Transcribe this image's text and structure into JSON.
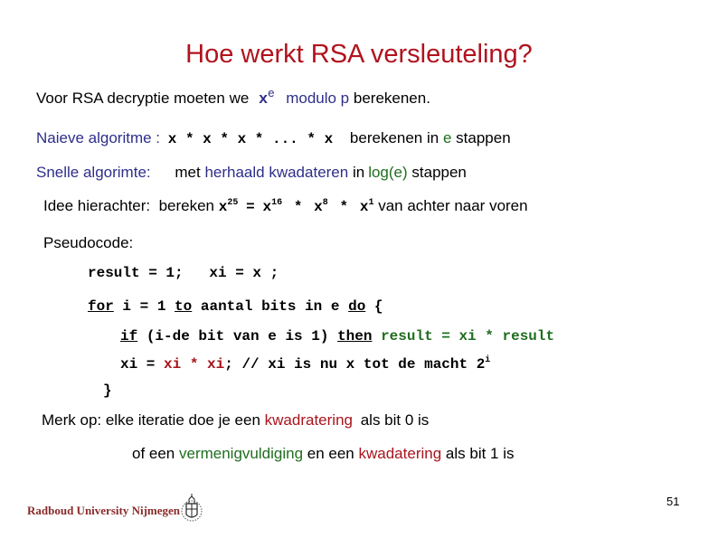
{
  "slide": {
    "title": "Hoe werkt RSA versleuteling?",
    "page_number": "51"
  },
  "line1": {
    "prefix": "Voor RSA decryptie moeten we",
    "math_base": "x",
    "math_exp": "e",
    "highlight": "modulo p",
    "suffix": "berekenen."
  },
  "naive": {
    "label": "Naieve algoritme :",
    "expr": "x * x * x * ... * x",
    "text_a": "berekenen in",
    "var": "e",
    "text_b": "stappen"
  },
  "fast": {
    "label": "Snelle algorimte:",
    "text_a": "met",
    "highlight": "herhaald kwadateren",
    "text_b": "in",
    "log": "log(e)",
    "text_c": "stappen"
  },
  "idea": {
    "prefix": "Idee hierachter:  bereken",
    "x": "x",
    "e25": "25",
    "eq": "=",
    "e16": "16",
    "star": "*",
    "e8": "8",
    "e1": "1",
    "suffix": "van achter naar voren"
  },
  "pseudocode": {
    "label": "Pseudocode:",
    "init": "result = 1;   xi = x ;",
    "for_kw": "for",
    "for_mid": "i = 1",
    "to_kw": "to",
    "for_rest": "aantal bits in e",
    "do_kw": "do",
    "brace_open": "{",
    "if_kw": "if",
    "if_cond": "(i-de bit van e is 1)",
    "then_kw": "then",
    "if_body": "result = xi * result",
    "sq_lhs": "xi =",
    "sq_rhs1": "xi",
    "sq_op": "*",
    "sq_rhs2": "xi",
    "sq_comment": "; // xi is nu x tot de macht 2",
    "sq_sup": "i",
    "brace_close": "}"
  },
  "note": {
    "line1_a": "Merk op: elke iteratie doe je een",
    "line1_red": "kwadratering",
    "line1_b": "als bit 0 is",
    "line2_a": "of een",
    "line2_green": "vermenigvuldiging",
    "line2_b": "en een",
    "line2_red": "kwadatering",
    "line2_c": "als bit 1 is"
  },
  "footer": {
    "university": "Radboud University Nijmegen",
    "crest_icon": "university-crest"
  }
}
